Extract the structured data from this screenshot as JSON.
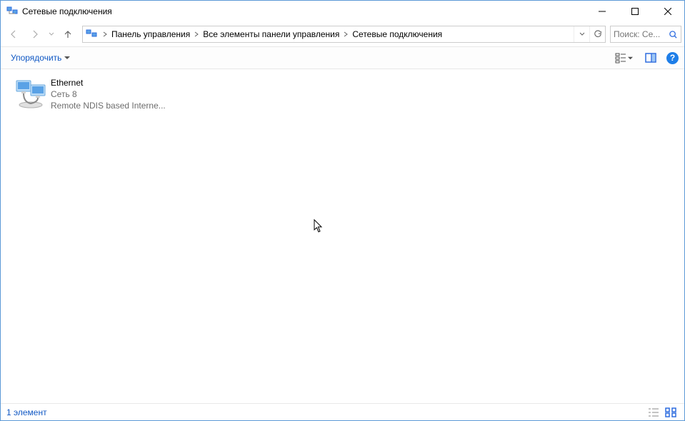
{
  "window": {
    "title": "Сетевые подключения"
  },
  "breadcrumbs": {
    "items": [
      "Панель управления",
      "Все элементы панели управления",
      "Сетевые подключения"
    ]
  },
  "search": {
    "placeholder": "Поиск: Се..."
  },
  "toolbar": {
    "organize": "Упорядочить"
  },
  "items": [
    {
      "name": "Ethernet",
      "network": "Сеть 8",
      "device": "Remote NDIS based Interne..."
    }
  ],
  "status": {
    "count": "1 элемент"
  }
}
